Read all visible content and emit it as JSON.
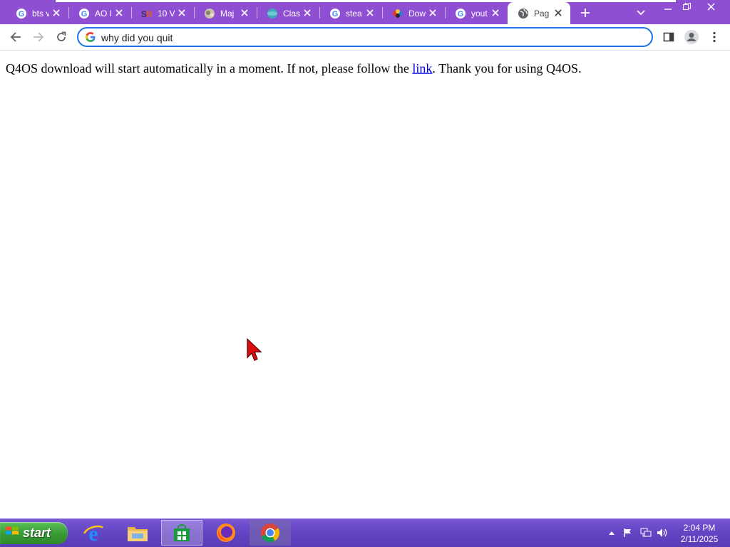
{
  "browser": {
    "tabs": [
      {
        "title": "bts v",
        "favicon": "google-icon"
      },
      {
        "title": "AO I",
        "favicon": "google-icon"
      },
      {
        "title": "10 V",
        "favicon": "sr-site-icon"
      },
      {
        "title": "Maj",
        "favicon": "majestic-site-icon"
      },
      {
        "title": "Clas",
        "favicon": "globe-site-icon"
      },
      {
        "title": "stea",
        "favicon": "google-icon"
      },
      {
        "title": "Dow",
        "favicon": "colorful-site-icon"
      },
      {
        "title": "yout",
        "favicon": "google-icon"
      },
      {
        "title": "Pag",
        "favicon": "globe-icon",
        "active": true
      }
    ],
    "address_bar": {
      "value": "why did you quit",
      "icon": "google-icon"
    },
    "accent_color": "#8f4fd3"
  },
  "page": {
    "message_before": "Q4OS download will start automatically in a moment. If not, please follow the ",
    "link_text": "link",
    "message_after": ". Thank you for using Q4OS."
  },
  "taskbar": {
    "start_label": "start",
    "apps": [
      "internet-explorer-icon",
      "file-explorer-icon",
      "store-icon",
      "firefox-icon",
      "chrome-icon"
    ],
    "active_app": "chrome-icon",
    "tray_icons": [
      "show-hidden-icons-chevron",
      "action-center-flag-icon",
      "network-icon",
      "volume-icon"
    ],
    "clock": {
      "time": "2:04 PM",
      "date": "2/11/2025"
    }
  }
}
